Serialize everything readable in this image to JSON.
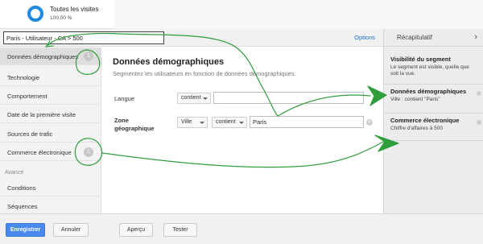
{
  "segment_card": {
    "title": "Toutes les visites",
    "subtitle": "100,00 %"
  },
  "name_bar": {
    "segment_name": "Paris - Utilisateur - CA > 500",
    "options_label": "Options"
  },
  "sidebar": {
    "items": [
      {
        "label": "Données démographiques",
        "badge": "1",
        "active": true
      },
      {
        "label": "Technologie"
      },
      {
        "label": "Comportement"
      },
      {
        "label": "Date de la première visite"
      },
      {
        "label": "Sources de trafic"
      },
      {
        "label": "Commerce électronique",
        "badge": "1"
      }
    ],
    "advanced_heading": "Avancé",
    "advanced_items": [
      {
        "label": "Conditions"
      },
      {
        "label": "Séquences"
      }
    ]
  },
  "main": {
    "title": "Données démographiques",
    "description": "Segmentez les utilisateurs en fonction de données démographiques.",
    "language_row": {
      "label": "Langue",
      "operator": "contient",
      "value": ""
    },
    "geo_row": {
      "label_line1": "Zone",
      "label_line2": "géographique",
      "dimension": "Ville",
      "operator": "contient",
      "value": "Paris"
    }
  },
  "summary": {
    "title": "Récapitulatif",
    "chevron": "›",
    "blocks": [
      {
        "title": "Visibilité du segment",
        "text": "Le segment est visible, quelle que soit la vue."
      },
      {
        "title": "Données démographiques",
        "text": "Ville : contient \"Paris\""
      },
      {
        "title": "Commerce électronique",
        "text": "Chiffre d'affaires à 500"
      }
    ]
  },
  "footer": {
    "save": "Enregistrer",
    "cancel": "Annuler",
    "preview": "Aperçu",
    "test": "Tester"
  },
  "colors": {
    "accent": "#4a8af0",
    "link": "#1a73c8",
    "annotation": "#2e9e3a",
    "segment_ring": "#1e88e5"
  },
  "icons": {
    "remove": "×"
  }
}
